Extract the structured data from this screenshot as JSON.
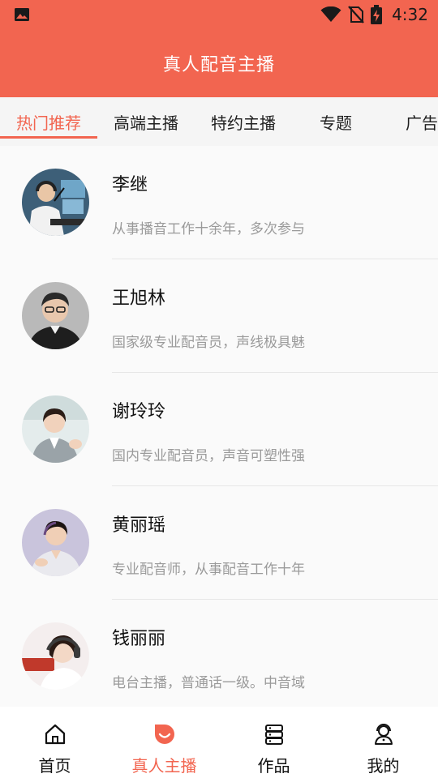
{
  "status_bar": {
    "time": "4:32",
    "icons": [
      "image-icon",
      "wifi-icon",
      "no-sim-icon",
      "battery-charging-icon"
    ]
  },
  "app_bar": {
    "title": "真人配音主播"
  },
  "tabs": [
    {
      "label": "热门推荐",
      "active": true
    },
    {
      "label": "高端主播",
      "active": false
    },
    {
      "label": "特约主播",
      "active": false
    },
    {
      "label": "专题",
      "active": false
    },
    {
      "label": "广告",
      "active": false
    }
  ],
  "anchors": [
    {
      "name": "李继",
      "description": "从事播音工作十余年，多次参与"
    },
    {
      "name": "王旭林",
      "description": "国家级专业配音员，声线极具魅"
    },
    {
      "name": "谢玲玲",
      "description": "国内专业配音员，声音可塑性强"
    },
    {
      "name": "黄丽瑶",
      "description": "专业配音师，从事配音工作十年"
    },
    {
      "name": "钱丽丽",
      "description": "电台主播，普通话一级。中音域"
    }
  ],
  "bottom_nav": [
    {
      "label": "首页",
      "icon": "home-icon",
      "active": false
    },
    {
      "label": "真人主播",
      "icon": "smile-bubble-icon",
      "active": true
    },
    {
      "label": "作品",
      "icon": "server-stack-icon",
      "active": false
    },
    {
      "label": "我的",
      "icon": "user-headset-icon",
      "active": false
    }
  ],
  "colors": {
    "accent": "#f26550",
    "text": "#111111",
    "muted": "#9a9a9a"
  }
}
